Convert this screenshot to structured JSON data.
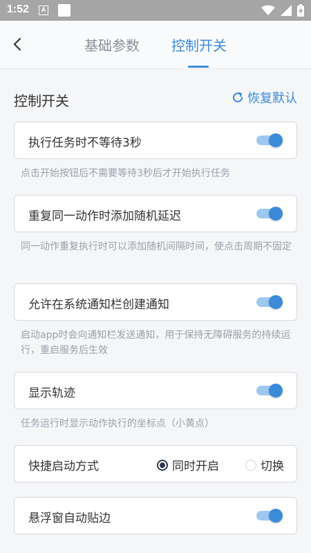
{
  "status_bar": {
    "time": "1:52",
    "notif_icon": "A"
  },
  "header": {
    "tabs": [
      {
        "label": "基础参数",
        "active": false
      },
      {
        "label": "控制开关",
        "active": true
      }
    ]
  },
  "section": {
    "title": "控制开关",
    "reset_label": "恢复默认"
  },
  "settings": [
    {
      "label": "执行任务时不等待3秒",
      "enabled": true,
      "desc": "点击开始按钮后不需要等待3秒后才开始执行任务"
    },
    {
      "label": "重复同一动作时添加随机延迟",
      "enabled": true,
      "desc": "同一动作重复执行时可以添加随机间隔时间，使点击周期不固定"
    },
    {
      "label": "允许在系统通知栏创建通知",
      "enabled": true,
      "desc": "启动app时会向通知栏发送通知，用于保持无障碍服务的持续运行，重启服务后生效"
    },
    {
      "label": "显示轨迹",
      "enabled": true,
      "desc": "任务运行时显示动作执行的坐标点（小黄点）"
    }
  ],
  "quick_start": {
    "label": "快捷启动方式",
    "options": [
      {
        "label": "同时开启",
        "selected": true
      },
      {
        "label": "切换",
        "selected": false
      }
    ]
  },
  "float_snap": {
    "label": "悬浮窗自动贴边",
    "enabled": true
  },
  "colors": {
    "accent": "#3b8bd9",
    "toggle_track": "#9ec8ef",
    "status_bar": "#a6a6a6"
  }
}
